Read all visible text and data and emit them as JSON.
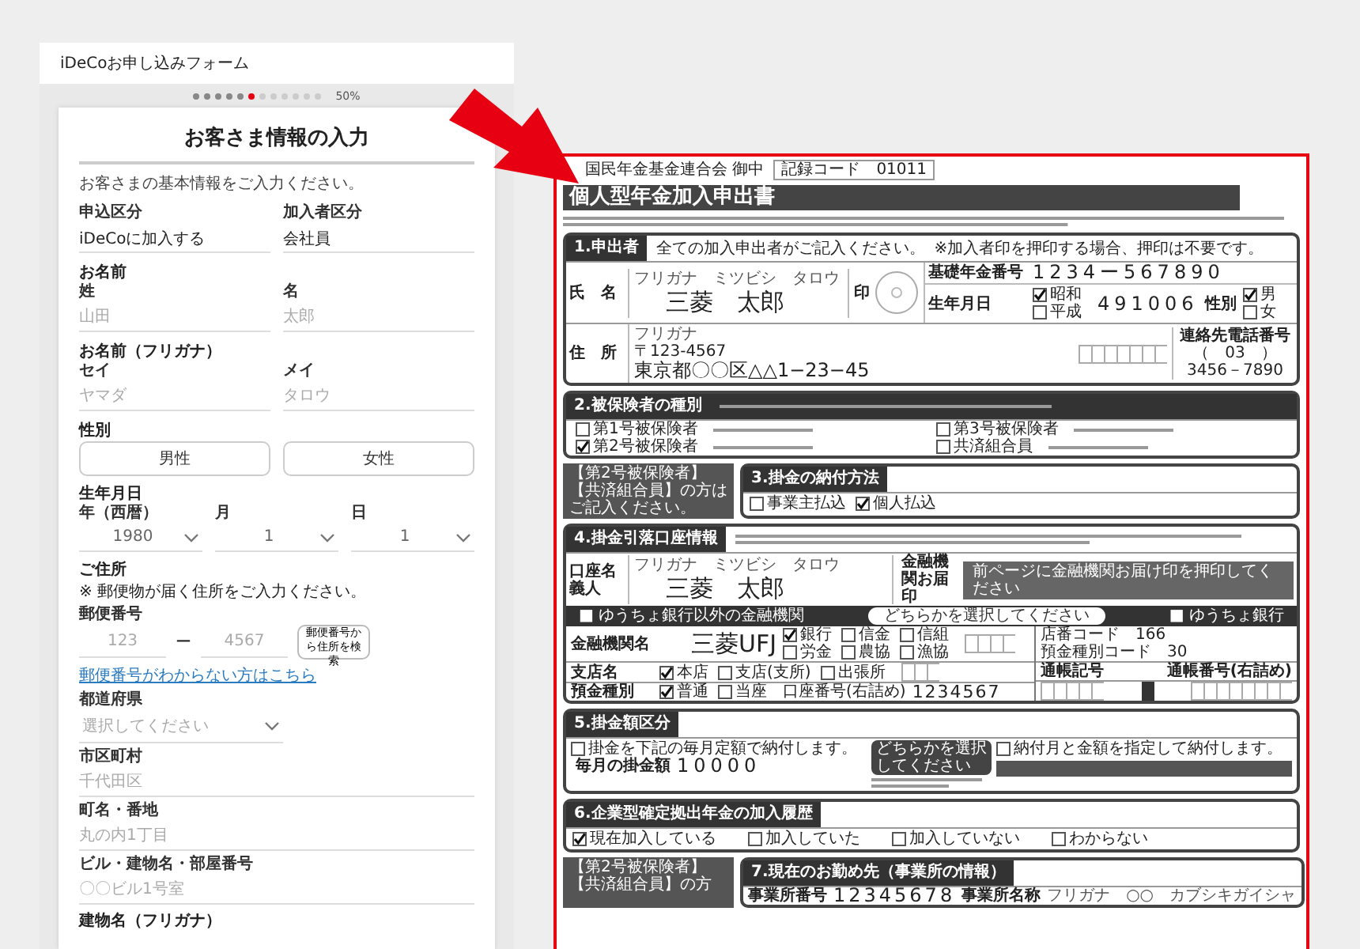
{
  "web_form": {
    "title": "iDeCoお申し込みフォーム",
    "progress_dots": [
      {
        "done": true,
        "selected": false
      },
      {
        "done": true,
        "selected": false
      },
      {
        "done": true,
        "selected": false
      },
      {
        "done": true,
        "selected": false
      },
      {
        "done": true,
        "selected": false
      },
      {
        "done": false,
        "selected": true
      },
      {
        "done": false,
        "selected": false
      },
      {
        "done": false,
        "selected": false
      },
      {
        "done": false,
        "selected": false
      },
      {
        "done": false,
        "selected": false
      },
      {
        "done": false,
        "selected": false
      },
      {
        "done": false,
        "selected": false
      }
    ],
    "progress_label": "50%",
    "heading": "お客さま情報の入力",
    "intro": "お客さまの基本情報をご入力ください。",
    "rows": [
      {
        "kind": "pair",
        "fields": [
          {
            "label": "申込区分",
            "value": "iDeCoに加入する"
          },
          {
            "label": "加入者区分",
            "value": "会社員"
          }
        ]
      },
      {
        "kind": "heading",
        "text": "お名前"
      },
      {
        "kind": "pair",
        "fields": [
          {
            "label": "姓",
            "placeholder": "山田"
          },
          {
            "label": "名",
            "placeholder": "太郎"
          }
        ]
      },
      {
        "kind": "heading",
        "text": "お名前（フリガナ）"
      },
      {
        "kind": "pair",
        "fields": [
          {
            "label": "セイ",
            "placeholder": "ヤマダ"
          },
          {
            "label": "メイ",
            "placeholder": "タロウ"
          }
        ]
      },
      {
        "kind": "heading",
        "text": "性別"
      },
      {
        "kind": "choice",
        "options": [
          {
            "label": "男性",
            "selected": false
          },
          {
            "label": "女性",
            "selected": false
          }
        ]
      },
      {
        "kind": "heading",
        "text": "生年月日"
      },
      {
        "kind": "selects",
        "fields": [
          {
            "label": "年（西暦）",
            "value": "1980"
          },
          {
            "label": "月",
            "value": "1"
          },
          {
            "label": "日",
            "value": "1"
          }
        ]
      },
      {
        "kind": "heading",
        "text": "ご住所"
      },
      {
        "kind": "note",
        "text": "※ 郵便物が届く住所をご入力ください。"
      },
      {
        "kind": "postal",
        "label": "郵便番号",
        "fields": [
          {
            "placeholder": "123"
          },
          {
            "placeholder": "4567"
          }
        ],
        "separator": "ー",
        "button": "郵便番号から住所を検索"
      },
      {
        "kind": "link",
        "text": "郵便番号がわからない方はこちら"
      },
      {
        "kind": "select",
        "label": "都道府県",
        "placeholder": "選択してください"
      },
      {
        "kind": "field",
        "label": "市区町村",
        "placeholder": "千代田区"
      },
      {
        "kind": "field",
        "label": "町名・番地",
        "placeholder": "丸の内1丁目"
      },
      {
        "kind": "field",
        "label": "ビル・建物名・部屋番号",
        "placeholder": "〇〇ビル1号室"
      },
      {
        "kind": "heading",
        "text": "建物名（フリガナ）"
      }
    ]
  },
  "application_form": {
    "addressee": "国民年金基金連合会 御中",
    "code_label": "記録コード",
    "code": "01011",
    "title": "個人型年金加入申出書",
    "applicant": {
      "title": "1.申出者",
      "note": "全ての加入申出者がご記入ください。",
      "note_2": "※加入者印を押印する場合、押印は不要です。",
      "name_label": "氏　名",
      "furigana": "フリガナ　ミツビシ　タロウ",
      "name": "三菱　太郎",
      "seal_label": "印",
      "pension_label": "基礎年金番号",
      "pension_number": "1234ー567890",
      "birth_label": "生年月日",
      "era": [
        {
          "label": "昭和",
          "checked": true
        },
        {
          "label": "平成",
          "checked": false
        }
      ],
      "birth_date": "491006",
      "sex_label": "性別",
      "sex": [
        {
          "label": "男",
          "checked": true
        },
        {
          "label": "女",
          "checked": false
        }
      ],
      "address_label": "住　所",
      "address_furigana": "フリガナ",
      "postal": "〒123-4567",
      "address": "東京都〇〇区△△1−23−45",
      "phone_label": "連絡先電話番号",
      "phone_area": "（　03　）",
      "phone": "3456－7890"
    },
    "insured_type": {
      "title": "2.被保険者の種別",
      "options": [
        {
          "label": "第1号被保険者",
          "checked": false
        },
        {
          "label": "第3号被保険者",
          "checked": false
        },
        {
          "label": "第2号被保険者",
          "checked": true
        },
        {
          "label": "共済組合員",
          "checked": false
        }
      ]
    },
    "side_note": "【第2号被保険者】【共済組合員】の方はご記入ください。",
    "payment_method": {
      "title": "3.掛金の納付方法",
      "options": [
        {
          "label": "事業主払込",
          "checked": false
        },
        {
          "label": "個人払込",
          "checked": true
        }
      ]
    },
    "bank": {
      "title": "4.掛金引落口座情報",
      "holder_label": "口座名義人",
      "furigana": "フリガナ　ミツビシ　タロウ",
      "holder": "三菱　太郎",
      "seal_label": "金融機関お届印",
      "seal_note": "前ページに金融機関お届け印を押印してください",
      "choice_left": "■ ゆうちょ銀行以外の金融機関",
      "choice_middle": "どちらかを選択してください",
      "choice_right": "■ ゆうちょ銀行",
      "bank_label": "金融機関名",
      "bank_name": "三菱UFJ",
      "bank_types": [
        {
          "label": "銀行",
          "checked": true
        },
        {
          "label": "信金",
          "checked": false
        },
        {
          "label": "信組",
          "checked": false
        },
        {
          "label": "労金",
          "checked": false
        },
        {
          "label": "農協",
          "checked": false
        },
        {
          "label": "漁協",
          "checked": false
        }
      ],
      "branch_label": "支店名",
      "branch_types": [
        {
          "label": "本店",
          "checked": true
        },
        {
          "label": "支店(支所)",
          "checked": false
        },
        {
          "label": "出張所",
          "checked": false
        }
      ],
      "account_label": "預金種別",
      "account_types": [
        {
          "label": "普通",
          "checked": true
        },
        {
          "label": "当座",
          "checked": false
        }
      ],
      "account_number_label": "口座番号(右詰め)",
      "account_number": "1234567",
      "store_code_label": "店番コード",
      "store_code": "166",
      "type_code_label": "預金種別コード",
      "type_code": "30",
      "passbook_mark_label": "通帳記号",
      "passbook_number_label": "通帳番号(右詰め)"
    },
    "contribution": {
      "title": "5.掛金額区分",
      "monthly": {
        "label": "掛金を下記の毎月定額で納付します。",
        "checked": false
      },
      "amount_label": "毎月の掛金額",
      "amount": "10000",
      "middle": "どちらかを選択してください",
      "annual": {
        "label": "納付月と金額を指定して納付します。",
        "checked": false
      }
    },
    "dc_history": {
      "title": "6.企業型確定拠出年金の加入履歴",
      "options": [
        {
          "label": "現在加入している",
          "checked": true
        },
        {
          "label": "加入していた",
          "checked": false
        },
        {
          "label": "加入していない",
          "checked": false
        },
        {
          "label": "わからない",
          "checked": false
        }
      ]
    },
    "employer": {
      "side_note": "【第2号被保険者】【共済組合員】の方",
      "title": "7.現在のお勤め先（事業所の情報）",
      "number_label": "事業所番号",
      "number": "12345678",
      "name_label": "事業所名称",
      "furigana": "フリガナ　○○　カブシキガイシャ"
    }
  }
}
